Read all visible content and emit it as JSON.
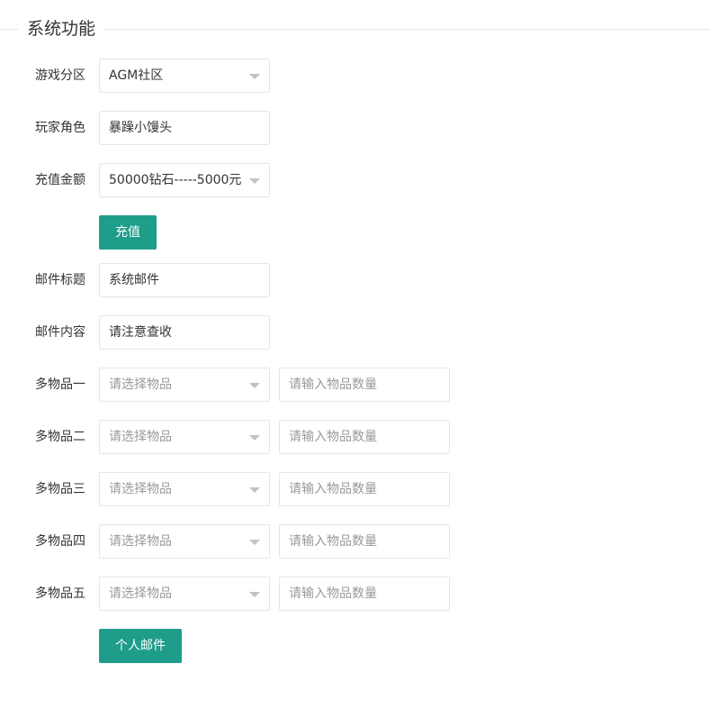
{
  "fieldset": {
    "legend": "系统功能"
  },
  "form": {
    "zone": {
      "label": "游戏分区",
      "value": "AGM社区"
    },
    "role": {
      "label": "玩家角色",
      "value": "暴躁小馒头"
    },
    "amount": {
      "label": "充值金额",
      "value": "50000钻石-----5000元"
    },
    "recharge_button": "充值",
    "mail_title": {
      "label": "邮件标题",
      "value": "系统邮件"
    },
    "mail_content": {
      "label": "邮件内容",
      "value": "请注意查收"
    },
    "items": [
      {
        "label": "多物品一",
        "select_placeholder": "请选择物品",
        "qty_placeholder": "请输入物品数量"
      },
      {
        "label": "多物品二",
        "select_placeholder": "请选择物品",
        "qty_placeholder": "请输入物品数量"
      },
      {
        "label": "多物品三",
        "select_placeholder": "请选择物品",
        "qty_placeholder": "请输入物品数量"
      },
      {
        "label": "多物品四",
        "select_placeholder": "请选择物品",
        "qty_placeholder": "请输入物品数量"
      },
      {
        "label": "多物品五",
        "select_placeholder": "请选择物品",
        "qty_placeholder": "请输入物品数量"
      }
    ],
    "mail_button": "个人邮件"
  },
  "colors": {
    "primary": "#1e9d8b",
    "border": "#e6e6e6",
    "placeholder": "#999999"
  }
}
